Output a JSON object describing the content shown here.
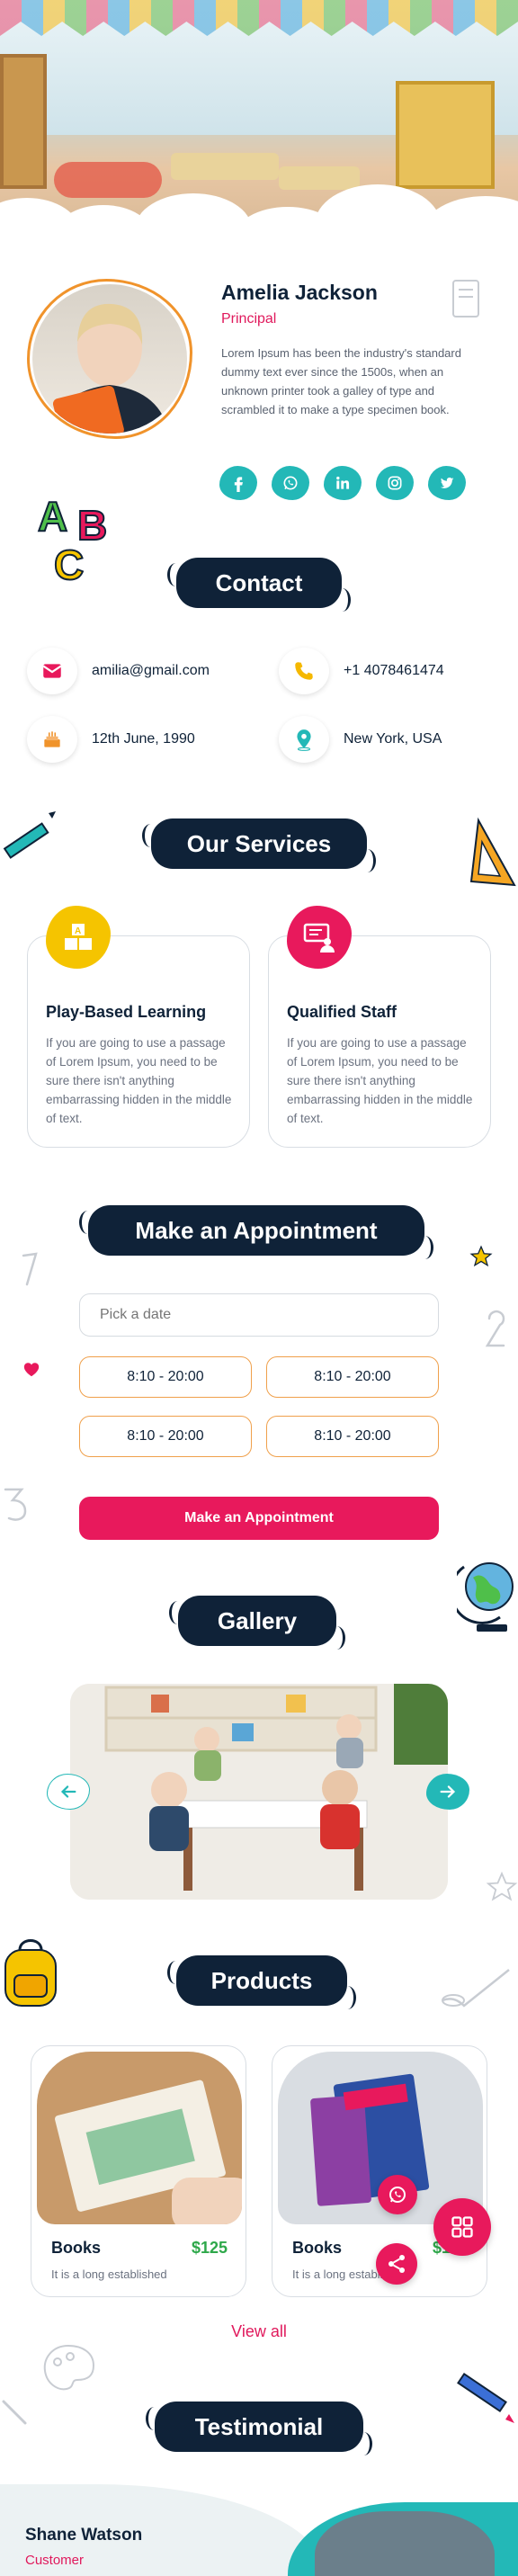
{
  "profile": {
    "name": "Amelia Jackson",
    "role": "Principal",
    "bio": "Lorem Ipsum has been the industry's standard dummy text ever since the 1500s, when an unknown printer took a galley of type and scrambled it to make a type specimen book.",
    "socials": [
      "facebook-icon",
      "whatsapp-icon",
      "linkedin-icon",
      "instagram-icon",
      "twitter-icon"
    ]
  },
  "contact": {
    "heading": "Contact",
    "email": "amilia@gmail.com",
    "phone": "+1 4078461474",
    "birthday": "12th June, 1990",
    "location": "New York, USA"
  },
  "services": {
    "heading": "Our Services",
    "items": [
      {
        "title": "Play-Based Learning",
        "desc": "If you are going to use a passage of Lorem Ipsum, you need to be sure there isn't anything embarrassing hidden in the middle of text.",
        "icon": "blocks-icon",
        "color": "#f5c400"
      },
      {
        "title": "Qualified Staff",
        "desc": "If you are going to use a passage of Lorem Ipsum, you need to be sure there isn't anything embarrassing hidden in the middle of text.",
        "icon": "teacher-icon",
        "color": "#e8195c"
      }
    ]
  },
  "appointment": {
    "heading": "Make an Appointment",
    "date_placeholder": "Pick a date",
    "slots": [
      "8:10 - 20:00",
      "8:10 - 20:00",
      "8:10 - 20:00",
      "8:10 - 20:00"
    ],
    "button": "Make an Appointment"
  },
  "gallery": {
    "heading": "Gallery"
  },
  "products": {
    "heading": "Products",
    "items": [
      {
        "name": "Books",
        "price": "$125",
        "desc": "It is a long established"
      },
      {
        "name": "Books",
        "price": "$125",
        "desc": "It is a long established"
      }
    ],
    "view_all": "View all"
  },
  "testimonial": {
    "heading": "Testimonial",
    "name": "Shane Watson",
    "role": "Customer"
  },
  "colors": {
    "navy": "#0f2238",
    "pink": "#e8195c",
    "teal": "#23b8b7",
    "orange": "#f0932b",
    "yellow": "#f5c400"
  }
}
